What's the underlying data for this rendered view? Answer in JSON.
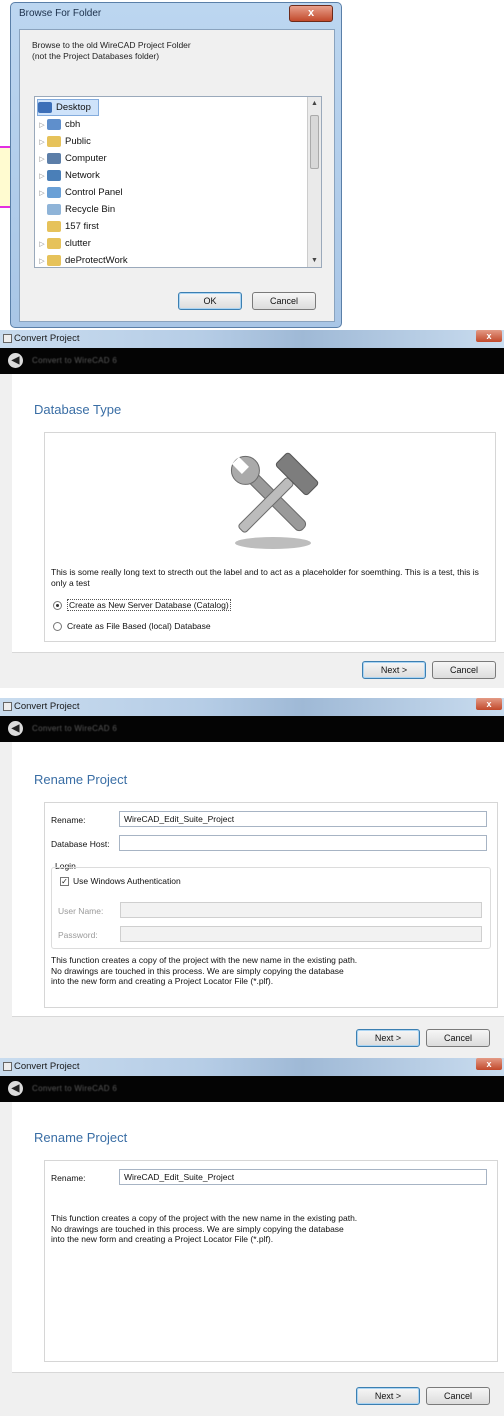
{
  "browse_dialog": {
    "title": "Browse For Folder",
    "close_glyph": "x",
    "instructions_line1": "Browse to the old WireCAD Project Folder",
    "instructions_line2": "(not the Project Databases folder)",
    "tree_items": [
      {
        "label": "Desktop",
        "icon": "desktop-icon",
        "color": "#3c6fb8",
        "expander": ""
      },
      {
        "label": "cbh",
        "icon": "user-folder-icon",
        "color": "#5f8fcc",
        "expander": "▷"
      },
      {
        "label": "Public",
        "icon": "folder-icon",
        "color": "#e6c25a",
        "expander": "▷"
      },
      {
        "label": "Computer",
        "icon": "computer-icon",
        "color": "#5c7ea8",
        "expander": "▷"
      },
      {
        "label": "Network",
        "icon": "network-icon",
        "color": "#4a7fb8",
        "expander": "▷"
      },
      {
        "label": "Control Panel",
        "icon": "control-panel-icon",
        "color": "#6aa0d6",
        "expander": "▷"
      },
      {
        "label": "Recycle Bin",
        "icon": "recycle-bin-icon",
        "color": "#8fb4d8",
        "expander": ""
      },
      {
        "label": "157 first",
        "icon": "folder-icon",
        "color": "#e6c25a",
        "expander": ""
      },
      {
        "label": "clutter",
        "icon": "folder-icon",
        "color": "#e6c25a",
        "expander": "▷"
      },
      {
        "label": "deProtectWork",
        "icon": "folder-icon",
        "color": "#e6c25a",
        "expander": "▷"
      }
    ],
    "ok_label": "OK",
    "cancel_label": "Cancel"
  },
  "window_title": "Convert Project",
  "close_glyph": "x",
  "back_glyph": "◀",
  "banner_text": "Convert to WireCAD 6",
  "database_type": {
    "heading": "Database Type",
    "description": "This is some really long text to strecth out the label and to act as a placeholder for soemthing. This is a test, this is only a test",
    "option_server": "Create as New Server Database (Catalog)",
    "option_file": "Create as File Based (local) Database",
    "selected": "server",
    "next_label": "Next >",
    "cancel_label": "Cancel"
  },
  "rename_with_login": {
    "heading": "Rename Project",
    "rename_label": "Rename:",
    "rename_value": "WireCAD_Edit_Suite_Project",
    "db_host_label": "Database Host:",
    "db_host_value": "",
    "login_group": "Login",
    "windows_auth_label": "Use Windows Authentication",
    "windows_auth_checked": true,
    "user_name_label": "User Name:",
    "password_label": "Password:",
    "info_line1": "This function creates a copy of the project with the new name in the existing path.",
    "info_line2": "No drawings are touched in this process. We are simply copying the database",
    "info_line3": "into the new form and creating a Project Locator File (*.plf).",
    "next_label": "Next >",
    "cancel_label": "Cancel"
  },
  "rename_simple": {
    "heading": "Rename Project",
    "rename_label": "Rename:",
    "rename_value": "WireCAD_Edit_Suite_Project",
    "info_line1": "This function creates a copy of the project with the new name in the existing path.",
    "info_line2": "No drawings are touched in this process. We are simply copying the database",
    "info_line3": "into the new form and creating a Project Locator File (*.plf).",
    "next_label": "Next >",
    "cancel_label": "Cancel"
  }
}
